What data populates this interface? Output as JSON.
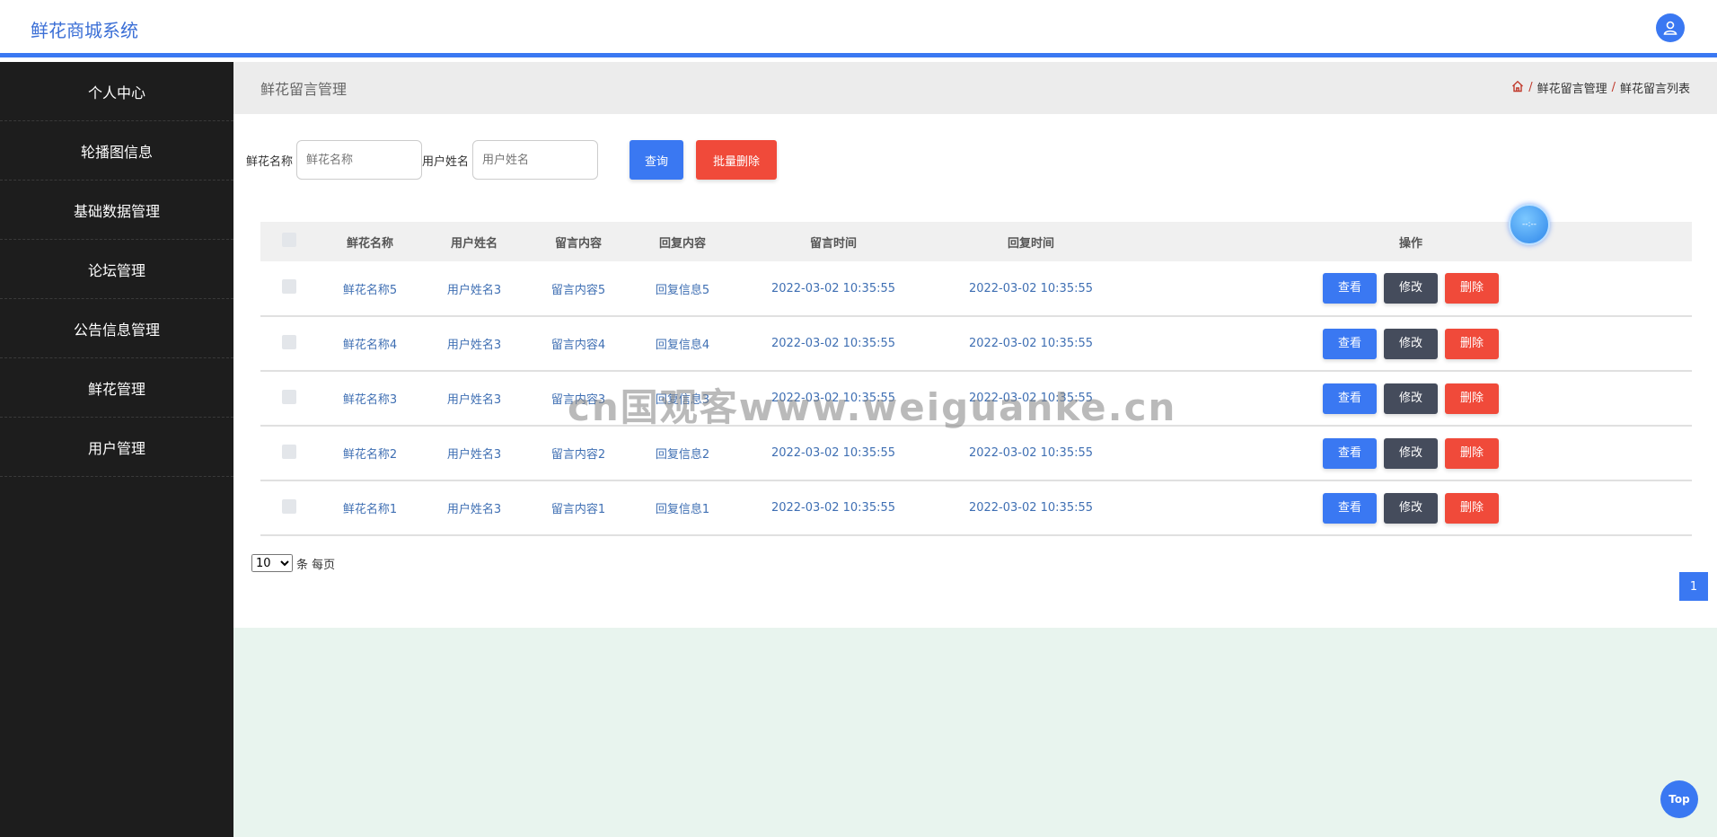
{
  "app": {
    "title": "鲜花商城系统"
  },
  "sidebar": {
    "items": [
      {
        "label": "个人中心"
      },
      {
        "label": "轮播图信息"
      },
      {
        "label": "基础数据管理"
      },
      {
        "label": "论坛管理"
      },
      {
        "label": "公告信息管理"
      },
      {
        "label": "鲜花管理"
      },
      {
        "label": "用户管理"
      }
    ]
  },
  "page": {
    "title": "鲜花留言管理",
    "breadcrumb": [
      "鲜花留言管理",
      "鲜花留言列表"
    ],
    "crumb_sep": "/"
  },
  "search": {
    "flower_label": "鲜花名称",
    "flower_placeholder": "鲜花名称",
    "user_label": "用户姓名",
    "user_placeholder": "用户姓名",
    "query_label": "查询",
    "batch_delete_label": "批量删除"
  },
  "table": {
    "headers": [
      "鲜花名称",
      "用户姓名",
      "留言内容",
      "回复内容",
      "留言时间",
      "回复时间",
      "操作"
    ],
    "rows": [
      [
        "鲜花名称5",
        "用户姓名3",
        "留言内容5",
        "回复信息5",
        "2022-03-02 10:35:55",
        "2022-03-02 10:35:55"
      ],
      [
        "鲜花名称4",
        "用户姓名3",
        "留言内容4",
        "回复信息4",
        "2022-03-02 10:35:55",
        "2022-03-02 10:35:55"
      ],
      [
        "鲜花名称3",
        "用户姓名3",
        "留言内容3",
        "回复信息3",
        "2022-03-02 10:35:55",
        "2022-03-02 10:35:55"
      ],
      [
        "鲜花名称2",
        "用户姓名3",
        "留言内容2",
        "回复信息2",
        "2022-03-02 10:35:55",
        "2022-03-02 10:35:55"
      ],
      [
        "鲜花名称1",
        "用户姓名3",
        "留言内容1",
        "回复信息1",
        "2022-03-02 10:35:55",
        "2022-03-02 10:35:55"
      ]
    ],
    "actions": {
      "view": "查看",
      "edit": "修改",
      "delete": "删除"
    }
  },
  "pagination": {
    "page_size": "10",
    "per_page_label": "条 每页",
    "current_page": "1"
  },
  "widgets": {
    "clock_text": "--:--",
    "top_label": "Top"
  },
  "watermark": "cn国观客www.weiguanke.cn",
  "colors": {
    "accent": "#3a78f2",
    "danger": "#f04a3a",
    "dark_button": "#454c5c",
    "sidebar": "#1d1d1d",
    "link": "#3f6fb3"
  }
}
